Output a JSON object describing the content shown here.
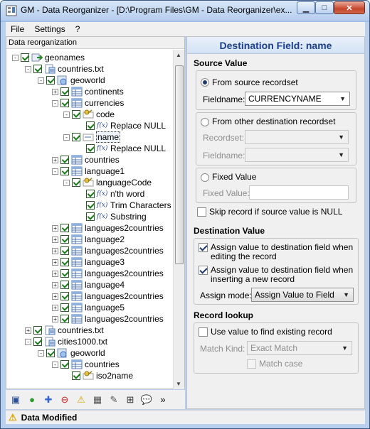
{
  "window": {
    "title": "GM - Data Reorganizer - [D:\\Program Files\\GM - Data Reorganizer\\ex..."
  },
  "menu": [
    "File",
    "Settings",
    "?"
  ],
  "left": {
    "header": "Data reorganization"
  },
  "tree": [
    {
      "level": 0,
      "exp": "-",
      "icon": "export-icon",
      "label": "geonames"
    },
    {
      "level": 1,
      "exp": "-",
      "icon": "file-icon",
      "label": "countries.txt"
    },
    {
      "level": 2,
      "exp": "-",
      "icon": "globe-table-icon",
      "label": "geoworld"
    },
    {
      "level": 3,
      "exp": "+",
      "icon": "table-icon",
      "label": "continents"
    },
    {
      "level": 3,
      "exp": "-",
      "icon": "table-icon",
      "label": "currencies"
    },
    {
      "level": 4,
      "exp": "-",
      "icon": "key-field-icon",
      "label": "code"
    },
    {
      "level": 5,
      "exp": "",
      "icon": "function-icon",
      "label": "Replace NULL"
    },
    {
      "level": 4,
      "exp": "-",
      "icon": "field-icon",
      "label": "name",
      "selected": true
    },
    {
      "level": 5,
      "exp": "",
      "icon": "function-icon",
      "label": "Replace NULL"
    },
    {
      "level": 3,
      "exp": "+",
      "icon": "table-icon",
      "label": "countries"
    },
    {
      "level": 3,
      "exp": "-",
      "icon": "table-icon",
      "label": "language1"
    },
    {
      "level": 4,
      "exp": "-",
      "icon": "key-field-icon",
      "label": "languageCode"
    },
    {
      "level": 5,
      "exp": "",
      "icon": "function-icon",
      "label": "n'th word"
    },
    {
      "level": 5,
      "exp": "",
      "icon": "function-icon",
      "label": "Trim Characters"
    },
    {
      "level": 5,
      "exp": "",
      "icon": "function-icon",
      "label": "Substring"
    },
    {
      "level": 3,
      "exp": "+",
      "icon": "table-icon",
      "label": "languages2countries"
    },
    {
      "level": 3,
      "exp": "+",
      "icon": "table-icon",
      "label": "language2"
    },
    {
      "level": 3,
      "exp": "+",
      "icon": "table-icon",
      "label": "languages2countries"
    },
    {
      "level": 3,
      "exp": "+",
      "icon": "table-icon",
      "label": "language3"
    },
    {
      "level": 3,
      "exp": "+",
      "icon": "table-icon",
      "label": "languages2countries"
    },
    {
      "level": 3,
      "exp": "+",
      "icon": "table-icon",
      "label": "language4"
    },
    {
      "level": 3,
      "exp": "+",
      "icon": "table-icon",
      "label": "languages2countries"
    },
    {
      "level": 3,
      "exp": "+",
      "icon": "table-icon",
      "label": "language5"
    },
    {
      "level": 3,
      "exp": "+",
      "icon": "table-icon",
      "label": "languages2countries"
    },
    {
      "level": 1,
      "exp": "+",
      "icon": "file-icon",
      "label": "countries.txt"
    },
    {
      "level": 1,
      "exp": "-",
      "icon": "file-icon",
      "label": "cities1000.txt"
    },
    {
      "level": 2,
      "exp": "-",
      "icon": "globe-table-icon",
      "label": "geoworld"
    },
    {
      "level": 3,
      "exp": "-",
      "icon": "table-icon",
      "label": "countries"
    },
    {
      "level": 4,
      "exp": "",
      "icon": "key-field-icon",
      "label": "iso2name"
    }
  ],
  "right": {
    "header": "Destination Field: name",
    "source_value": {
      "title": "Source Value",
      "from_source": "From source recordset",
      "fieldname_label": "Fieldname:",
      "fieldname_value": "CURRENCYNAME",
      "from_other": "From other destination recordset",
      "recordset_label": "Recordset:",
      "fieldname2_label": "Fieldname:",
      "fixed": "Fixed Value",
      "fixed_label": "Fixed Value:",
      "skip": "Skip record if source value is NULL"
    },
    "destination_value": {
      "title": "Destination Value",
      "assign_edit": "Assign value to destination field when",
      "assign_edit2": "editing the record",
      "assign_insert": "Assign value to destination field when",
      "assign_insert2": "inserting a new record",
      "mode_label": "Assign mode:",
      "mode_value": "Assign Value to Field"
    },
    "record_lookup": {
      "title": "Record lookup",
      "use_value": "Use value to find existing record",
      "match_kind_label": "Match Kind:",
      "match_kind_value": "Exact Match",
      "match_case": "Match case"
    }
  },
  "status": {
    "text": "Data Modified"
  }
}
